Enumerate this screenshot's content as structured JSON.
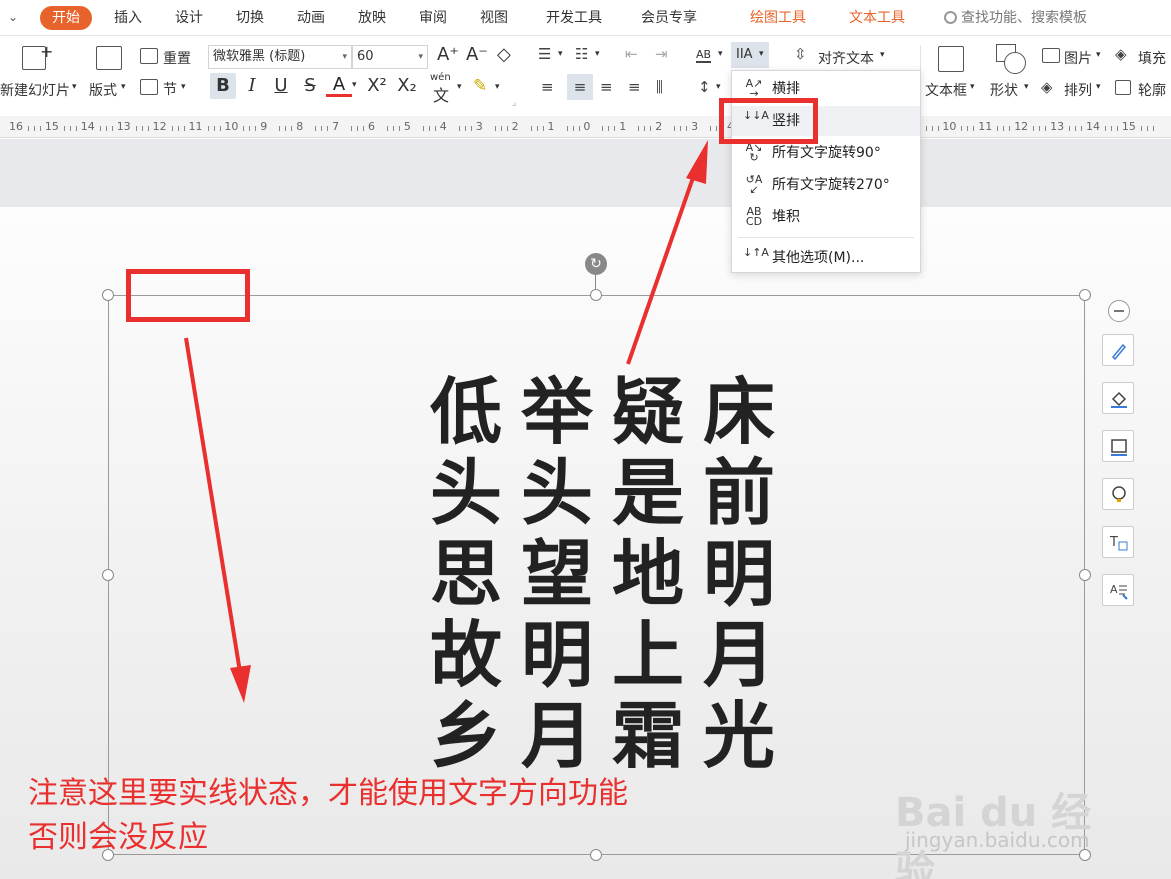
{
  "tabs": [
    {
      "label": "开始",
      "state": "active"
    },
    {
      "label": "插入"
    },
    {
      "label": "设计"
    },
    {
      "label": "切换"
    },
    {
      "label": "动画"
    },
    {
      "label": "放映"
    },
    {
      "label": "审阅"
    },
    {
      "label": "视图"
    },
    {
      "label": "开发工具"
    },
    {
      "label": "会员专享"
    },
    {
      "label": "绘图工具",
      "state": "contextual"
    },
    {
      "label": "文本工具",
      "state": "contextual"
    }
  ],
  "search": {
    "label": "查找功能、搜索模板"
  },
  "ribbon": {
    "new_slide": "新建幻灯片",
    "layout": "版式",
    "reset": "重置",
    "section": "节",
    "font_name": "微软雅黑 (标题)",
    "font_size": "60",
    "text_direction": "IIA",
    "align_text": "对齐文本",
    "textbox": "文本框",
    "shape": "形状",
    "picture": "图片",
    "arrange": "排列",
    "fill": "填充",
    "outline": "轮廓",
    "wen_label": "wén"
  },
  "ruler": {
    "labels": [
      "16",
      "15",
      "14",
      "13",
      "12",
      "11",
      "10",
      "9",
      "8",
      "7",
      "6",
      "5",
      "4",
      "3",
      "2",
      "1",
      "0",
      "1",
      "2",
      "3",
      "4",
      "5",
      "6",
      "7",
      "8",
      "9",
      "10",
      "11",
      "12",
      "13",
      "14",
      "15"
    ]
  },
  "dropdown": {
    "items": [
      {
        "label": "横排",
        "icon": "horizontal-text-icon"
      },
      {
        "label": "竖排",
        "icon": "vertical-text-icon",
        "state": "highlighted"
      },
      {
        "label": "所有文字旋转90°",
        "icon": "rotate-90-icon"
      },
      {
        "label": "所有文字旋转270°",
        "icon": "rotate-270-icon"
      },
      {
        "label": "堆积",
        "icon": "stacked-text-icon"
      },
      {
        "label": "其他选项(M)...",
        "icon": "more-options-icon"
      }
    ]
  },
  "poem": {
    "columns": [
      "低头思故乡",
      "举头望明月",
      "疑是地上霜",
      "床前明月光"
    ]
  },
  "annotation": {
    "line1": "注意这里要实线状态，才能使用文字方向功能",
    "line2": "否则会没反应"
  },
  "watermark": {
    "brand": "Bai du 经验",
    "url": "jingyan.baidu.com"
  },
  "colors": {
    "accent": "#e8632b",
    "annotation_red": "#e9302f",
    "poem_text": "#222222"
  }
}
